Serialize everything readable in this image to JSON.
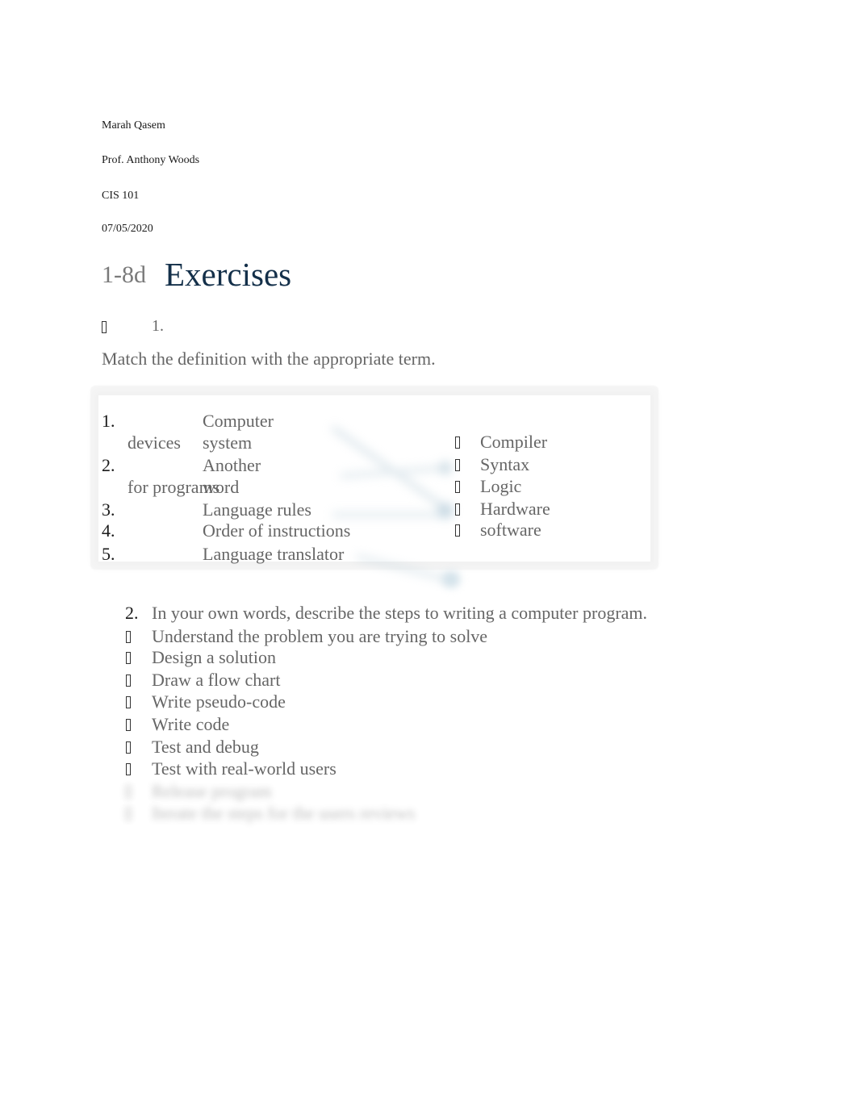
{
  "header": {
    "student": "Marah Qasem",
    "professor": "Prof. Anthony Woods",
    "course": "CIS 101",
    "date": "07/05/2020"
  },
  "section": {
    "number": "1-8d",
    "title": "Exercises"
  },
  "question1": {
    "bullet_icon": "missing-glyph-icon",
    "number": "1.",
    "prompt": "Match the definition with the appropriate term.",
    "definitions": [
      {
        "num": "1.",
        "text": "Computer system",
        "continuation": "devices"
      },
      {
        "num": "2.",
        "text": "Another word",
        "continuation": "for programs"
      },
      {
        "num": "3.",
        "text": "Language rules"
      },
      {
        "num": "4.",
        "text": "Order of instructions"
      },
      {
        "num": "5.",
        "text": "Language translator"
      }
    ],
    "terms": [
      "Compiler",
      "Syntax",
      "Logic",
      "Hardware",
      "software"
    ]
  },
  "question2": {
    "number": "2.",
    "prompt": "In your own words, describe the steps to writing a computer program.",
    "steps": [
      "Understand the problem you are trying to solve",
      "Design a solution",
      "Draw a flow chart",
      "Write pseudo-code",
      "Write code",
      "Test and debug",
      "Test with real-world users"
    ],
    "obscured_steps": [
      "Release program",
      "Iterate the steps for the users reviews"
    ]
  },
  "colors": {
    "title": "#14304a",
    "body_text": "#666666",
    "section_number": "#7a7a7a"
  }
}
